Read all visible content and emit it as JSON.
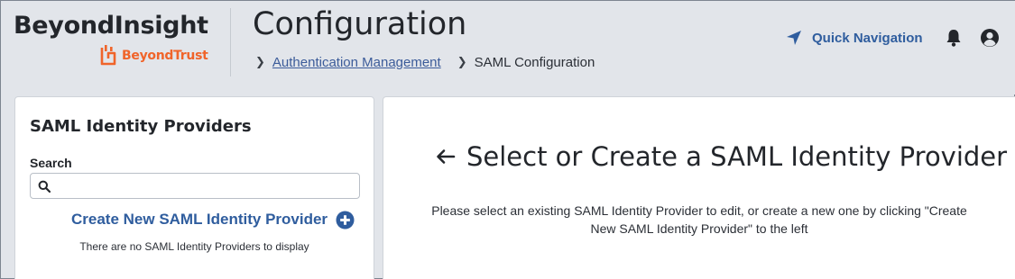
{
  "brand": {
    "product": "BeyondInsight",
    "company": "BeyondTrust",
    "accent_color": "#f0642a"
  },
  "header": {
    "title": "Configuration",
    "breadcrumb": {
      "link_label": "Authentication Management",
      "current_label": "SAML Configuration"
    },
    "quick_nav_label": "Quick Navigation",
    "icons": [
      "location-arrow-icon",
      "bell-icon",
      "user-circle-icon"
    ]
  },
  "sidebar": {
    "title": "SAML Identity Providers",
    "search_label": "Search",
    "search_value": "",
    "search_placeholder": "",
    "create_label": "Create New SAML Identity Provider",
    "empty_message": "There are no SAML Identity Providers to display"
  },
  "main": {
    "heading": "Select or Create a SAML Identity Provider",
    "description": "Please select an existing SAML Identity Provider to edit, or create a new one by clicking \"Create New SAML Identity Provider\" to the left"
  },
  "colors": {
    "link": "#2f5d9e",
    "background": "#e2e5ea",
    "panel": "#ffffff"
  }
}
